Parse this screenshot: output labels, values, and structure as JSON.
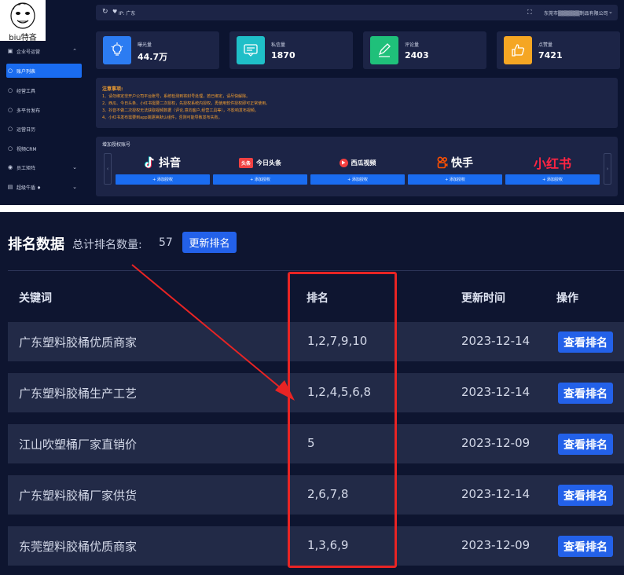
{
  "sidebar": {
    "logo_text": "biu特吝",
    "items": [
      {
        "label": "企业号运营",
        "icon": "monitor-icon",
        "chev": "⌃"
      },
      {
        "label": "账户列表",
        "icon": "circle-icon",
        "active": true
      },
      {
        "label": "经营工具",
        "icon": "circle-icon"
      },
      {
        "label": "多平台发布",
        "icon": "circle-icon"
      },
      {
        "label": "运营日历",
        "icon": "circle-icon"
      },
      {
        "label": "视频CRM",
        "icon": "circle-icon"
      },
      {
        "label": "员工矩阵",
        "icon": "radio-icon",
        "chev": "⌄"
      },
      {
        "label": "超级牛盾 ♦",
        "icon": "shield-icon",
        "chev": "⌄"
      }
    ]
  },
  "topbar": {
    "ip_label": "IP: 广东",
    "company": "东莞市▒▒▒▒▒▒制品有限公司"
  },
  "stats": [
    {
      "label": "曝光量",
      "value": "44.7万",
      "icon": "bulb-icon",
      "color": "#2c7cf2"
    },
    {
      "label": "私信量",
      "value": "1870",
      "icon": "message-icon",
      "color": "#1fbfc8"
    },
    {
      "label": "评论量",
      "value": "2403",
      "icon": "edit-icon",
      "color": "#1fc07a"
    },
    {
      "label": "点赞量",
      "value": "7421",
      "icon": "thumb-icon",
      "color": "#f5a623"
    }
  ],
  "notice": {
    "title": "注意事项:",
    "lines": [
      "1、请勿绑定非开户公司平台账号，系统检测到将封号处理，若已绑定，请尽快解除。",
      "2、西瓜、今日头条、小红书需要二次授权，先授权系统内授权，再使用软件授权即可正常使用。",
      "3、抖音不做二次授权无法获取视频数据（评论,意向客户,经营工具等），不影响发布视频。",
      "4、小红书发布需要到app端更换默认组件，否则可能导致发布失败。"
    ]
  },
  "auth": {
    "title": "增加授权账号",
    "button_label": "+ 添加授权",
    "platforms": [
      {
        "name": "抖音",
        "icon": "douyin-icon"
      },
      {
        "name": "今日头条",
        "icon": "toutiao-icon",
        "badge": "头条"
      },
      {
        "name": "西瓜视频",
        "icon": "xigua-icon"
      },
      {
        "name": "快手",
        "icon": "kuaishou-icon"
      },
      {
        "name": "小红书",
        "icon": "xiaohongshu-icon"
      }
    ]
  },
  "ranking": {
    "title": "排名数据",
    "count_label": "总计排名数量:",
    "count": "57",
    "update_button": "更新排名",
    "columns": [
      "关键词",
      "排名",
      "更新时间",
      "操作"
    ],
    "row_button": "查看排名",
    "rows": [
      {
        "keyword": "广东塑料胶桶优质商家",
        "rank": "1,2,7,9,10",
        "date": "2023-12-14"
      },
      {
        "keyword": "广东塑料胶桶生产工艺",
        "rank": "1,2,4,5,6,8",
        "date": "2023-12-14"
      },
      {
        "keyword": "江山吹塑桶厂家直销价",
        "rank": "5",
        "date": "2023-12-09"
      },
      {
        "keyword": "广东塑料胶桶厂家供货",
        "rank": "2,6,7,8",
        "date": "2023-12-14"
      },
      {
        "keyword": "东莞塑料胶桶优质商家",
        "rank": "1,3,6,9",
        "date": "2023-12-09"
      }
    ]
  },
  "annotation": {
    "box_color": "#e82424",
    "arrow_color": "#e82424"
  }
}
